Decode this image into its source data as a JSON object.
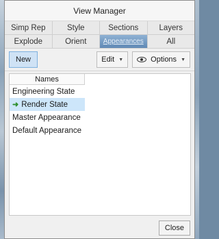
{
  "window": {
    "title": "View Manager"
  },
  "tabs_row1": [
    "Simp Rep",
    "Style",
    "Sections",
    "Layers"
  ],
  "tabs_row2": [
    {
      "label": "Explode",
      "active": false
    },
    {
      "label": "Orient",
      "active": false
    },
    {
      "label": "Appearances",
      "active": true
    },
    {
      "label": "All",
      "active": false
    }
  ],
  "toolbar": {
    "new_label": "New",
    "edit_label": "Edit",
    "options_label": "Options"
  },
  "list": {
    "column_header": "Names",
    "items": [
      {
        "label": "Engineering State",
        "selected": false,
        "active_marker": false
      },
      {
        "label": "Render State",
        "selected": true,
        "active_marker": true
      },
      {
        "label": "Master Appearance",
        "selected": false,
        "active_marker": false
      },
      {
        "label": "Default Appearance",
        "selected": false,
        "active_marker": false
      }
    ]
  },
  "footer": {
    "close_label": "Close"
  },
  "colors": {
    "active_tab": "#6f96c0",
    "selected_row": "#cde6fa",
    "new_button": "#cfe2f5",
    "active_arrow": "#2f8f2f"
  }
}
